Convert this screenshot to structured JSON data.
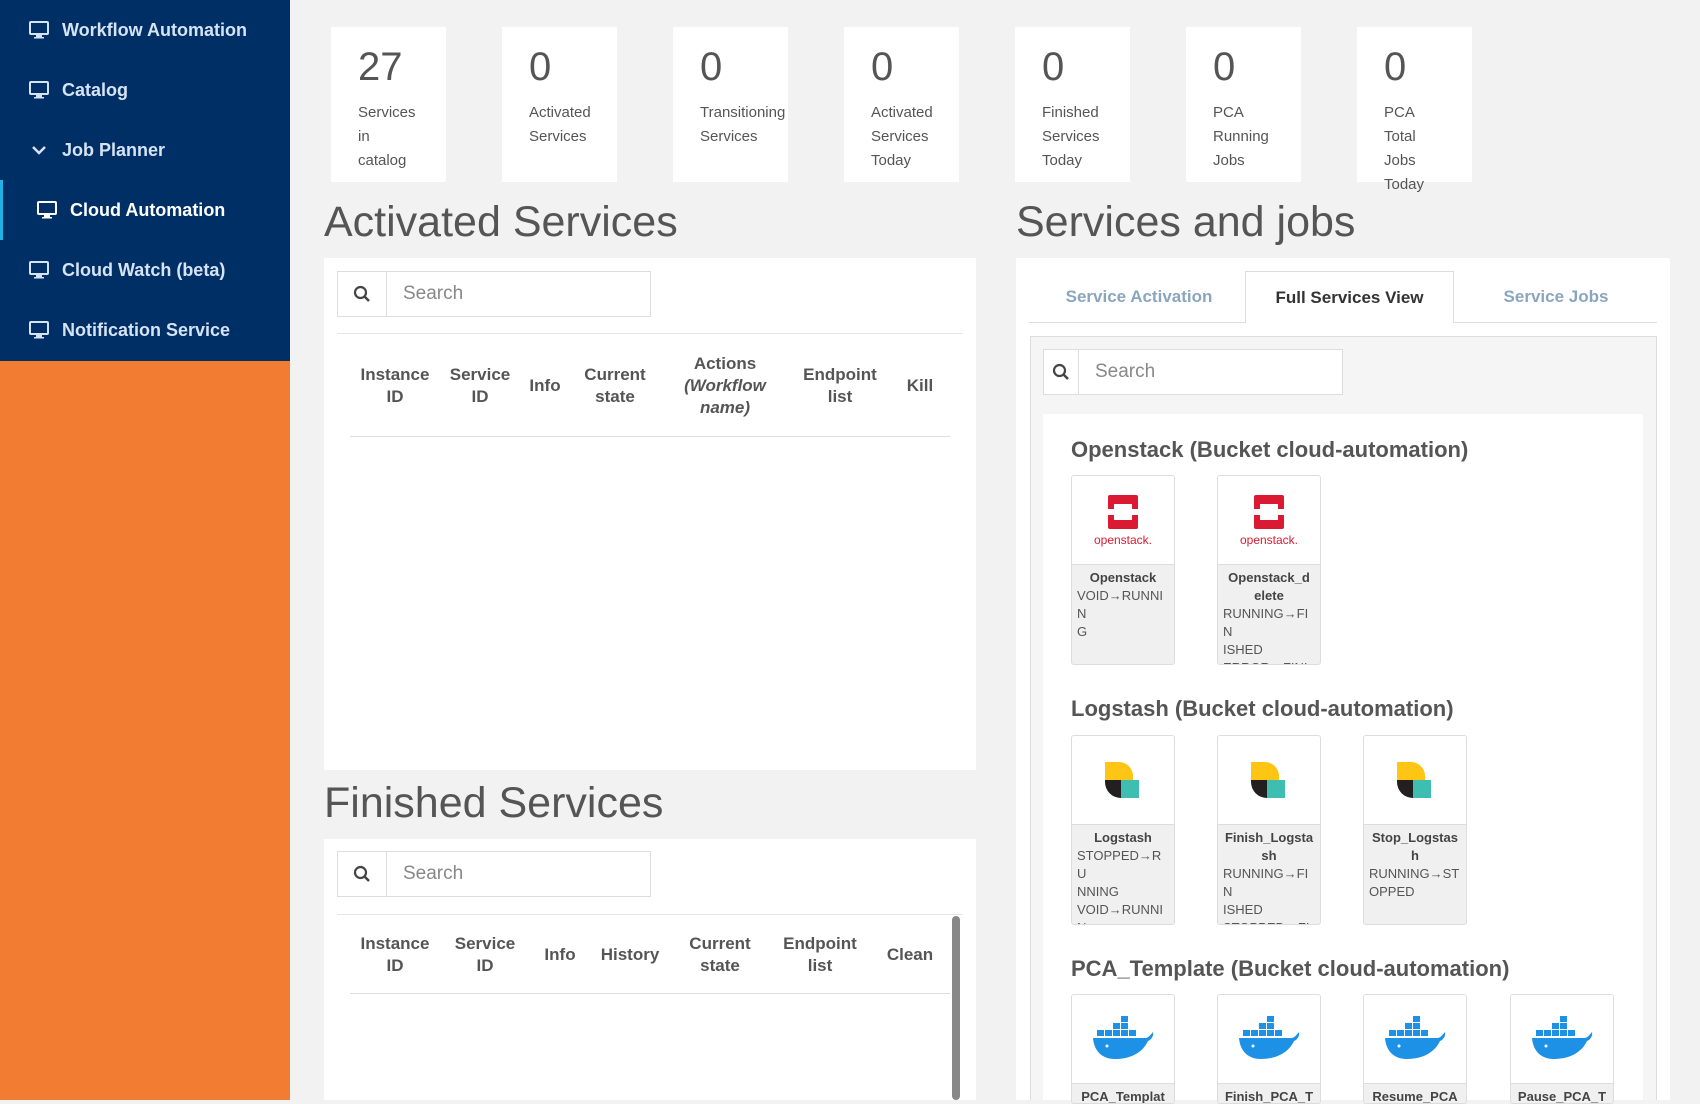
{
  "sidebar": {
    "items": [
      {
        "label": "Workflow Automation",
        "icon": "monitor-icon"
      },
      {
        "label": "Catalog",
        "icon": "monitor-icon"
      },
      {
        "label": "Job Planner",
        "icon": "chevron-down-icon"
      },
      {
        "label": "Cloud Automation",
        "icon": "monitor-icon",
        "active": true
      },
      {
        "label": "Cloud Watch (beta)",
        "icon": "monitor-icon"
      },
      {
        "label": "Notification Service",
        "icon": "monitor-icon"
      }
    ]
  },
  "stats": [
    {
      "value": "27",
      "label": "Services\nin\ncatalog"
    },
    {
      "value": "0",
      "label": "Activated\nServices"
    },
    {
      "value": "0",
      "label": "Transitioning\nServices"
    },
    {
      "value": "0",
      "label": "Activated\nServices\nToday"
    },
    {
      "value": "0",
      "label": "Finished\nServices\nToday"
    },
    {
      "value": "0",
      "label": "PCA\nRunning\nJobs"
    },
    {
      "value": "0",
      "label": "PCA\nTotal\nJobs\nToday"
    }
  ],
  "activated": {
    "title": "Activated Services",
    "search_placeholder": "Search",
    "columns": [
      "Instance\nID",
      "Service\nID",
      "Info",
      "Current\nstate",
      "Actions",
      "(Workflow\nname)",
      "Endpoint\nlist",
      "Kill"
    ]
  },
  "finished": {
    "title": "Finished Services",
    "search_placeholder": "Search",
    "columns": [
      "Instance\nID",
      "Service\nID",
      "Info",
      "History",
      "Current\nstate",
      "Endpoint\nlist",
      "Clean"
    ]
  },
  "services_jobs": {
    "title": "Services and jobs",
    "tabs": [
      "Service Activation",
      "Full Services View",
      "Service Jobs"
    ],
    "active_tab": "Full Services View",
    "search_placeholder": "Search",
    "buckets": [
      {
        "title": "Openstack (Bucket cloud-automation)",
        "logo": "openstack-logo-icon",
        "logo_text": "openstack.",
        "cards": [
          {
            "name": "Openstack",
            "states": "VOID→RUNNIN\nG"
          },
          {
            "name": "Openstack_d\nelete",
            "states": "RUNNING→FIN\nISHED\nERROR→FINISH"
          }
        ]
      },
      {
        "title": "Logstash (Bucket cloud-automation)",
        "logo": "logstash-logo-icon",
        "cards": [
          {
            "name": "Logstash",
            "states": "STOPPED→RU\nNNING\nVOID→RUNNIN\nG"
          },
          {
            "name": "Finish_Logsta\nsh",
            "states": "RUNNING→FIN\nISHED\nSTOPPED→FINI"
          },
          {
            "name": "Stop_Logstas\nh",
            "states": "RUNNING→ST\nOPPED"
          }
        ]
      },
      {
        "title": "PCA_Template (Bucket cloud-automation)",
        "logo": "docker-whale-icon",
        "cards": [
          {
            "name": "PCA_Templat",
            "states": ""
          },
          {
            "name": "Finish_PCA_Te",
            "states": ""
          },
          {
            "name": "Resume_PCA",
            "states": ""
          },
          {
            "name": "Pause_PCA_Te",
            "states": ""
          }
        ]
      }
    ]
  },
  "colors": {
    "sidebar_nav": "#002f66",
    "sidebar_bg": "#f27c32",
    "active_border": "#1fb3e6",
    "openstack_red": "#da1a32",
    "logstash_yellow": "#fec514",
    "logstash_teal": "#3ebeb0",
    "docker_blue": "#1d91e6"
  }
}
